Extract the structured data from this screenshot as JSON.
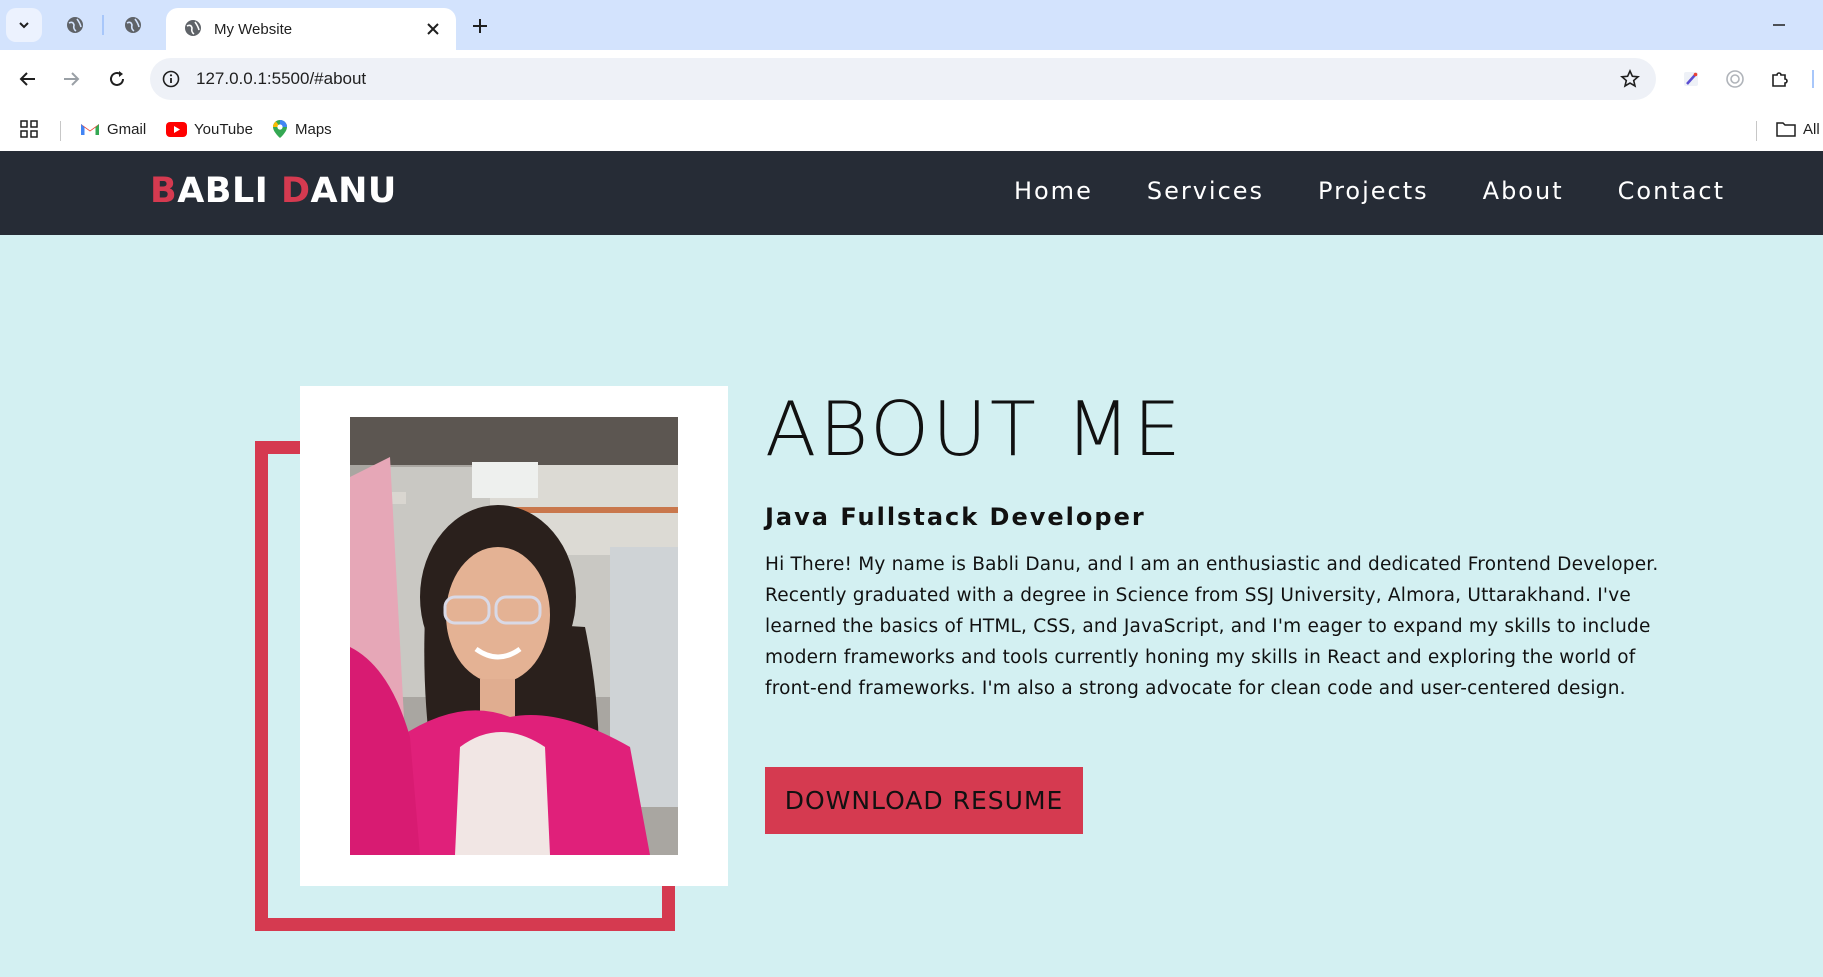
{
  "browser": {
    "tab_title": "My Website",
    "url": "127.0.0.1:5500/#about",
    "bookmarks": [
      {
        "label": "Gmail"
      },
      {
        "label": "YouTube"
      },
      {
        "label": "Maps"
      }
    ],
    "all_bookmarks_label": "All"
  },
  "site": {
    "logo_first_initial": "B",
    "logo_first_rest": "ABLI ",
    "logo_last_initial": "D",
    "logo_last_rest": "ANU",
    "nav": [
      "Home",
      "Services",
      "Projects",
      "About",
      "Contact"
    ],
    "accent_color": "#d53a50",
    "nav_bg": "#262c36",
    "page_bg": "#d3f0f2"
  },
  "about": {
    "title": "ABOUT ME",
    "subtitle": "Java Fullstack Developer",
    "paragraph_lines": [
      "Hi There! My name is Babli Danu, and I am an enthusiastic and dedicated Frontend Developer.",
      "Recently graduated with a degree in Science from SSJ University, Almora, Uttarakhand. I've",
      "learned the basics of HTML, CSS, and JavaScript, and I'm eager to expand my skills to include",
      "modern frameworks and tools currently honing my skills in React and exploring the world of",
      "front-end frameworks. I'm also a strong advocate for clean code and user-centered design."
    ],
    "button_label": "DOWNLOAD RESUME"
  }
}
